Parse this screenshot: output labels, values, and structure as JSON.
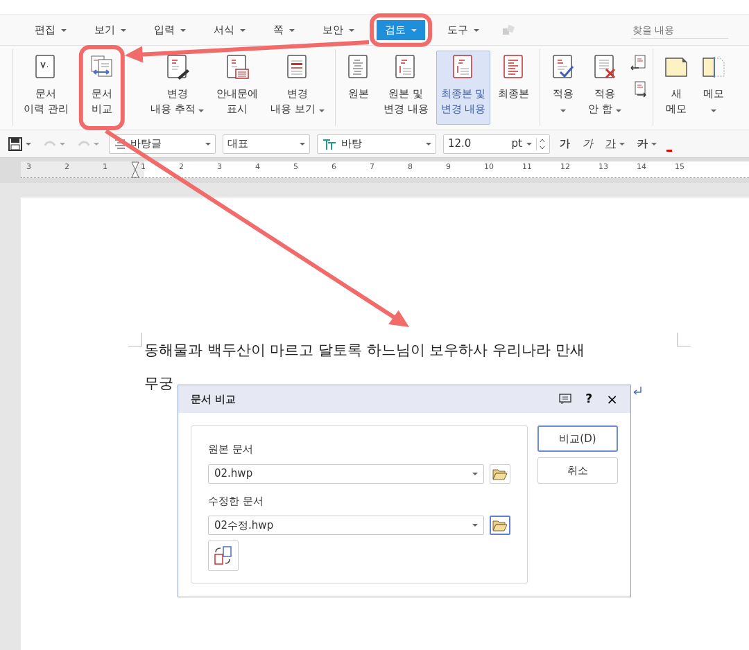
{
  "menu_tabs": [
    {
      "label": "편집",
      "selected": false
    },
    {
      "label": "보기",
      "selected": false
    },
    {
      "label": "입력",
      "selected": false
    },
    {
      "label": "서식",
      "selected": false
    },
    {
      "label": "쪽",
      "selected": false
    },
    {
      "label": "보안",
      "selected": false
    },
    {
      "label": "검토",
      "selected": true
    },
    {
      "label": "도구",
      "selected": false
    }
  ],
  "search": {
    "placeholder": "찾을 내용"
  },
  "ribbon_groups": [
    {
      "buttons": [
        {
          "lines": [
            "문서",
            "이력 관리"
          ],
          "menu": false,
          "selected": false
        },
        {
          "lines": [
            "문서",
            "비교"
          ],
          "menu": false,
          "selected": false
        },
        {
          "lines": [
            "변경",
            "내용 추적"
          ],
          "menu": true,
          "selected": false
        },
        {
          "lines": [
            "안내문에",
            "표시"
          ],
          "menu": false,
          "selected": false
        },
        {
          "lines": [
            "변경",
            "내용 보기"
          ],
          "menu": true,
          "selected": false
        }
      ]
    },
    {
      "buttons": [
        {
          "lines": [
            "원본"
          ],
          "menu": false,
          "selected": false
        },
        {
          "lines": [
            "원본 및",
            "변경 내용"
          ],
          "menu": false,
          "selected": false
        },
        {
          "lines": [
            "최종본 및",
            "변경 내용"
          ],
          "menu": false,
          "selected": true
        },
        {
          "lines": [
            "최종본"
          ],
          "menu": false,
          "selected": false
        }
      ]
    },
    {
      "buttons": [
        {
          "lines": [
            "적용"
          ],
          "menu": true,
          "selected": false
        },
        {
          "lines": [
            "적용",
            "안 함"
          ],
          "menu": true,
          "selected": false
        }
      ]
    },
    {
      "buttons": [
        {
          "lines": [
            "새",
            "메모"
          ],
          "menu": false,
          "selected": false
        },
        {
          "lines": [
            "메모"
          ],
          "menu": true,
          "selected": false
        }
      ]
    }
  ],
  "toolbar": {
    "style": "바탕글",
    "style_set": "대표",
    "font": "바탕",
    "size": "12.0",
    "unit": "pt",
    "format_buttons": [
      {
        "label": "가",
        "kind": "bold",
        "menu": false
      },
      {
        "label": "가",
        "kind": "italic",
        "menu": false
      },
      {
        "label": "가",
        "kind": "underline",
        "menu": true
      },
      {
        "label": "가",
        "kind": "strike",
        "menu": true
      }
    ]
  },
  "ruler": {
    "left_labels": [
      "3",
      "2",
      "1"
    ],
    "right_labels": [
      "1",
      "2",
      "3",
      "4",
      "5",
      "6",
      "7",
      "8",
      "9",
      "10",
      "11",
      "12",
      "13",
      "14",
      "15"
    ]
  },
  "document": {
    "lines": [
      "동해물과 백두산이 마르고 달토록 하느님이 보우하사 우리나라 만새",
      "무궁"
    ]
  },
  "dialog": {
    "title": "문서 비교",
    "fields": [
      {
        "label": "원본 문서",
        "value": "02.hwp",
        "focused": false
      },
      {
        "label": "수정한 문서",
        "value": "02수정.hwp",
        "focused": true
      }
    ],
    "buttons": [
      {
        "label": "비교(D)",
        "default": true
      },
      {
        "label": "취소",
        "default": false
      }
    ],
    "help": "?",
    "close": "×"
  }
}
